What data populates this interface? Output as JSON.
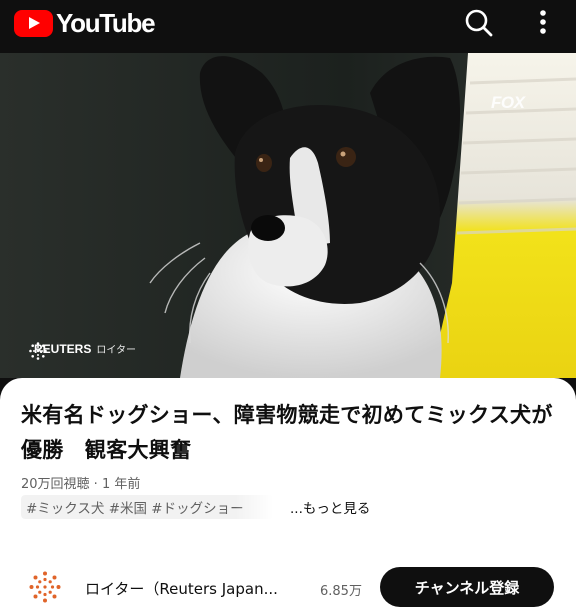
{
  "header": {
    "logo_text": "YouTube",
    "search_icon": "search-icon",
    "more_icon": "more-vert-icon"
  },
  "video": {
    "watermark_top_right": "FOX",
    "watermark_reuters": "REUTERS",
    "watermark_reuters_jp": "ロイター"
  },
  "info": {
    "title": "米有名ドッグショー、障害物競走で初めてミックス犬が優勝　観客大興奮",
    "views": "20万回視聴",
    "age": "1 年前",
    "meta_separator": " · ",
    "hashtags": "#ミックス犬 #米国 #ドッグショー",
    "more_label": "...もっと見る"
  },
  "channel": {
    "name": "ロイター（Reuters Japan...",
    "subscribers": "6.85万",
    "subscribe_label": "チャンネル登録",
    "avatar_icon": "reuters-logo-icon"
  },
  "colors": {
    "brand_red": "#ff0000",
    "background": "#0f0f0f",
    "panel": "#ffffff"
  }
}
